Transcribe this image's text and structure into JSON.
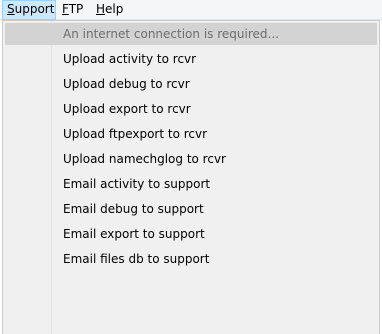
{
  "menubar": {
    "items": [
      {
        "accel": "S",
        "rest": "upport"
      },
      {
        "accel": "F",
        "rest": "TP"
      },
      {
        "accel": "H",
        "rest": "elp"
      }
    ]
  },
  "dropdown": {
    "items": [
      {
        "label": "An internet connection is required...",
        "enabled": false
      },
      {
        "label": "Upload activity to rcvr",
        "enabled": true
      },
      {
        "label": "Upload debug to rcvr",
        "enabled": true
      },
      {
        "label": "Upload export to rcvr",
        "enabled": true
      },
      {
        "label": "Upload ftpexport to rcvr",
        "enabled": true
      },
      {
        "label": "Upload namechglog to rcvr",
        "enabled": true
      },
      {
        "label": "Email activity to support",
        "enabled": true
      },
      {
        "label": "Email debug to support",
        "enabled": true
      },
      {
        "label": "Email export to support",
        "enabled": true
      },
      {
        "label": "Email files db to support",
        "enabled": true
      }
    ]
  }
}
